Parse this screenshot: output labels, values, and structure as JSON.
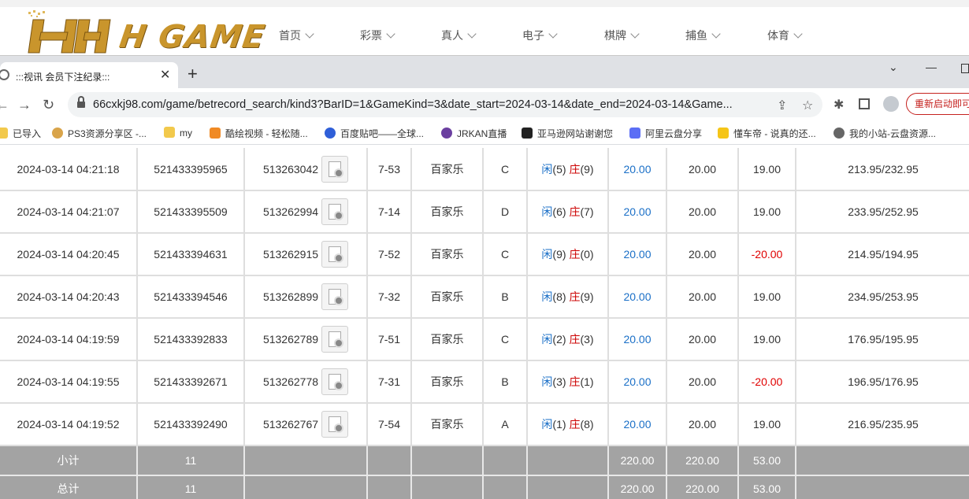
{
  "site": {
    "brand": "H GAME",
    "nav": [
      "首页",
      "彩票",
      "真人",
      "电子",
      "棋牌",
      "捕鱼",
      "体育"
    ]
  },
  "browser": {
    "tab_title": ":::视讯 会员下注纪录:::",
    "url": "66cxkj98.com/game/betrecord_search/kind3?BarID=1&GameKind=3&date_start=2024-03-14&date_end=2024-03-14&Game...",
    "restart_label": "重新启动即可",
    "bookmarks": [
      "已导入",
      "PS3资源分享区 -...",
      "my",
      "酷绘视频 - 轻松随...",
      "百度贴吧——全球...",
      "JRKAN直播",
      "亚马逊网站谢谢您",
      "阿里云盘分享",
      "懂车帝 - 说真的还...",
      "我的小站-云盘资源..."
    ]
  },
  "records": [
    {
      "time": "2024-03-14 04:21:18",
      "order": "521433395965",
      "round": "513263042",
      "table": "7-53",
      "game": "百家乐",
      "bet_area": "C",
      "player_label": "闲",
      "player": "(5)",
      "banker_label": "庄",
      "banker": "(9)",
      "bet": "20.00",
      "valid": "20.00",
      "result": "19.00",
      "balance": "213.95/232.95",
      "loss": false
    },
    {
      "time": "2024-03-14 04:21:07",
      "order": "521433395509",
      "round": "513262994",
      "table": "7-14",
      "game": "百家乐",
      "bet_area": "D",
      "player_label": "闲",
      "player": "(6)",
      "banker_label": "庄",
      "banker": "(7)",
      "bet": "20.00",
      "valid": "20.00",
      "result": "19.00",
      "balance": "233.95/252.95",
      "loss": false
    },
    {
      "time": "2024-03-14 04:20:45",
      "order": "521433394631",
      "round": "513262915",
      "table": "7-52",
      "game": "百家乐",
      "bet_area": "C",
      "player_label": "闲",
      "player": "(9)",
      "banker_label": "庄",
      "banker": "(0)",
      "bet": "20.00",
      "valid": "20.00",
      "result": "-20.00",
      "balance": "214.95/194.95",
      "loss": true
    },
    {
      "time": "2024-03-14 04:20:43",
      "order": "521433394546",
      "round": "513262899",
      "table": "7-32",
      "game": "百家乐",
      "bet_area": "B",
      "player_label": "闲",
      "player": "(8)",
      "banker_label": "庄",
      "banker": "(9)",
      "bet": "20.00",
      "valid": "20.00",
      "result": "19.00",
      "balance": "234.95/253.95",
      "loss": false
    },
    {
      "time": "2024-03-14 04:19:59",
      "order": "521433392833",
      "round": "513262789",
      "table": "7-51",
      "game": "百家乐",
      "bet_area": "C",
      "player_label": "闲",
      "player": "(2)",
      "banker_label": "庄",
      "banker": "(3)",
      "bet": "20.00",
      "valid": "20.00",
      "result": "19.00",
      "balance": "176.95/195.95",
      "loss": false
    },
    {
      "time": "2024-03-14 04:19:55",
      "order": "521433392671",
      "round": "513262778",
      "table": "7-31",
      "game": "百家乐",
      "bet_area": "B",
      "player_label": "闲",
      "player": "(3)",
      "banker_label": "庄",
      "banker": "(1)",
      "bet": "20.00",
      "valid": "20.00",
      "result": "-20.00",
      "balance": "196.95/176.95",
      "loss": true
    },
    {
      "time": "2024-03-14 04:19:52",
      "order": "521433392490",
      "round": "513262767",
      "table": "7-54",
      "game": "百家乐",
      "bet_area": "A",
      "player_label": "闲",
      "player": "(1)",
      "banker_label": "庄",
      "banker": "(8)",
      "bet": "20.00",
      "valid": "20.00",
      "result": "19.00",
      "balance": "216.95/235.95",
      "loss": false
    }
  ],
  "subtotal": {
    "label": "小计",
    "count": "11",
    "bet": "220.00",
    "valid": "220.00",
    "result": "53.00"
  },
  "total": {
    "label": "总计",
    "count": "11",
    "bet": "220.00",
    "valid": "220.00",
    "result": "53.00"
  },
  "colors": {
    "player": "#1a6fc7",
    "banker": "#cc0000",
    "loss": "#e00000",
    "summary_bg": "#a3a3a3",
    "brand_gold": "#c9952c"
  }
}
